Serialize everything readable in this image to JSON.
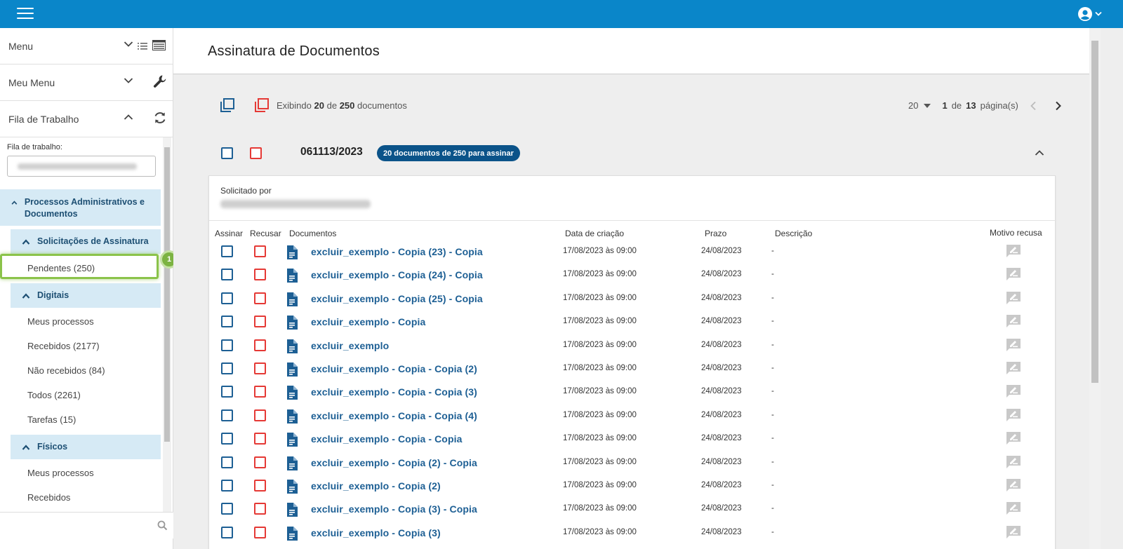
{
  "header": {
    "menu_icon": "hamburger-icon",
    "user_icon": "user-circle-icon"
  },
  "sidebar": {
    "menu_label": "Menu",
    "meu_menu_label": "Meu Menu",
    "fila_header_label": "Fila de Trabalho",
    "fila_field_label": "Fila de trabalho:",
    "groups": {
      "proc_admin": "Processos Administrativos e Documentos",
      "solicitacoes": "Solicitações de Assinatura",
      "digitais": "Digitais",
      "fisicos": "Físicos"
    },
    "items": {
      "pendentes": "Pendentes (250)",
      "meus_processos": "Meus processos",
      "recebidos": "Recebidos (2177)",
      "nao_recebidos": "Não recebidos (84)",
      "todos": "Todos (2261)",
      "tarefas": "Tarefas (15)",
      "fis_meus_processos": "Meus processos",
      "fis_recebidos": "Recebidos"
    },
    "step_badge": "1"
  },
  "main": {
    "title": "Assinatura de Documentos",
    "counts": {
      "prefix": "Exibindo",
      "shown": "20",
      "of": "de",
      "total": "250",
      "suffix": "documentos"
    },
    "pager": {
      "page_size": "20",
      "current": "1",
      "of": "de",
      "pages": "13",
      "suffix": "página(s)"
    },
    "process": {
      "number": "061113/2023",
      "badge": "20 documentos de 250 para assinar"
    },
    "card": {
      "solicitado_label": "Solicitado por"
    },
    "columns": {
      "assinar": "Assinar",
      "recusar": "Recusar",
      "documentos": "Documentos",
      "data": "Data de criação",
      "prazo": "Prazo",
      "descricao": "Descrição",
      "motivo": "Motivo recusa"
    },
    "rows": [
      {
        "doc": "excluir_exemplo - Copia (23) - Copia",
        "data": "17/08/2023 às 09:00",
        "prazo": "24/08/2023",
        "descricao": "-"
      },
      {
        "doc": "excluir_exemplo - Copia (24) - Copia",
        "data": "17/08/2023 às 09:00",
        "prazo": "24/08/2023",
        "descricao": "-"
      },
      {
        "doc": "excluir_exemplo - Copia (25) - Copia",
        "data": "17/08/2023 às 09:00",
        "prazo": "24/08/2023",
        "descricao": "-"
      },
      {
        "doc": "excluir_exemplo - Copia",
        "data": "17/08/2023 às 09:00",
        "prazo": "24/08/2023",
        "descricao": "-"
      },
      {
        "doc": "excluir_exemplo",
        "data": "17/08/2023 às 09:00",
        "prazo": "24/08/2023",
        "descricao": "-"
      },
      {
        "doc": "excluir_exemplo - Copia - Copia (2)",
        "data": "17/08/2023 às 09:00",
        "prazo": "24/08/2023",
        "descricao": "-"
      },
      {
        "doc": "excluir_exemplo - Copia - Copia (3)",
        "data": "17/08/2023 às 09:00",
        "prazo": "24/08/2023",
        "descricao": "-"
      },
      {
        "doc": "excluir_exemplo - Copia - Copia (4)",
        "data": "17/08/2023 às 09:00",
        "prazo": "24/08/2023",
        "descricao": "-"
      },
      {
        "doc": "excluir_exemplo - Copia - Copia",
        "data": "17/08/2023 às 09:00",
        "prazo": "24/08/2023",
        "descricao": "-"
      },
      {
        "doc": "excluir_exemplo - Copia (2) - Copia",
        "data": "17/08/2023 às 09:00",
        "prazo": "24/08/2023",
        "descricao": "-"
      },
      {
        "doc": "excluir_exemplo - Copia (2)",
        "data": "17/08/2023 às 09:00",
        "prazo": "24/08/2023",
        "descricao": "-"
      },
      {
        "doc": "excluir_exemplo - Copia (3) - Copia",
        "data": "17/08/2023 às 09:00",
        "prazo": "24/08/2023",
        "descricao": "-"
      },
      {
        "doc": "excluir_exemplo - Copia (3)",
        "data": "17/08/2023 às 09:00",
        "prazo": "24/08/2023",
        "descricao": "-"
      }
    ]
  },
  "colors": {
    "topbar": "#0a86c9",
    "accent_dark": "#0b5389",
    "link": "#1d5f94",
    "reject": "#e53935",
    "group_bg": "#d6eaf5",
    "highlight": "#8bc34a"
  }
}
